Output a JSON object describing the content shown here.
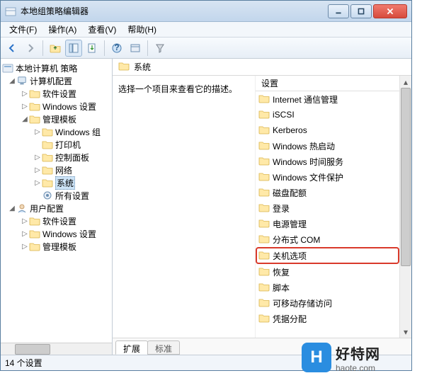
{
  "window": {
    "title": "本地组策略编辑器"
  },
  "menubar": {
    "file": "文件(F)",
    "action": "操作(A)",
    "view": "查看(V)",
    "help": "帮助(H)"
  },
  "tree": {
    "root_label": "本地计算机 策略",
    "computer_config": "计算机配置",
    "software_settings": "软件设置",
    "windows_settings": "Windows 设置",
    "admin_templates": "管理模板",
    "windows_components": "Windows 组",
    "printers": "打印机",
    "control_panel": "控制面板",
    "network": "网络",
    "system": "系统",
    "all_settings": "所有设置",
    "user_config": "用户配置",
    "u_software_settings": "软件设置",
    "u_windows_settings": "Windows 设置",
    "u_admin_templates": "管理模板"
  },
  "content": {
    "header_title": "系统",
    "description_prompt": "选择一个项目来查看它的描述。",
    "column_header": "设置",
    "items": [
      "Internet 通信管理",
      "iSCSI",
      "Kerberos",
      "Windows 热启动",
      "Windows 时间服务",
      "Windows 文件保护",
      "磁盘配额",
      "登录",
      "电源管理",
      "分布式 COM",
      "关机选项",
      "恢复",
      "脚本",
      "可移动存储访问",
      "凭据分配"
    ],
    "highlight_index": 10
  },
  "tabs": {
    "extended": "扩展",
    "standard": "标准"
  },
  "statusbar": {
    "text": "14 个设置"
  },
  "watermark": {
    "big": "好特网",
    "small": "haote.com",
    "logo_letter": "H"
  }
}
